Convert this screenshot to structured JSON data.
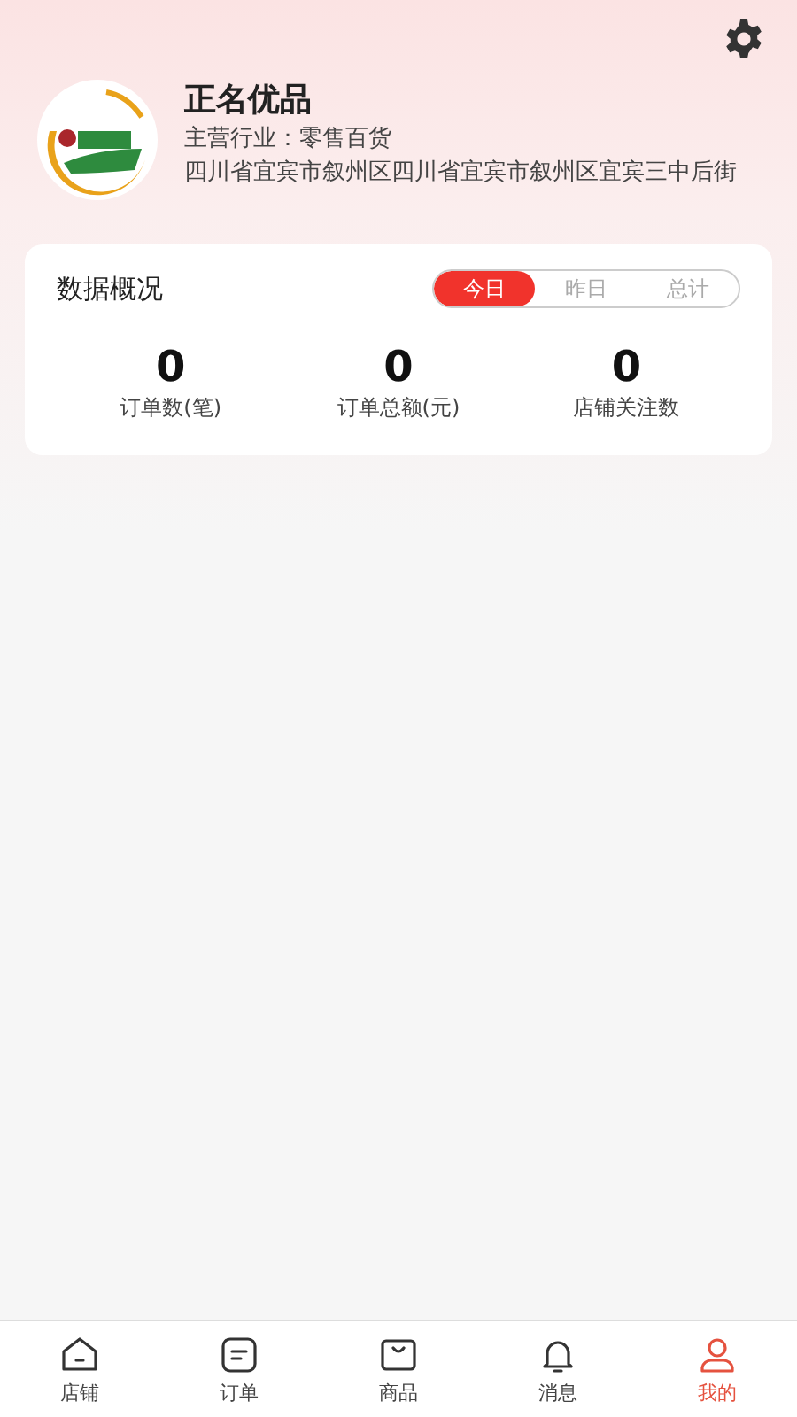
{
  "store": {
    "name": "正名优品",
    "industry": "主营行业：零售百货",
    "address": "四川省宜宾市叙州区四川省宜宾市叙州区宜宾三中后街"
  },
  "overview": {
    "title": "数据概况",
    "tabs": [
      {
        "label": "今日",
        "selected": true
      },
      {
        "label": "昨日",
        "selected": false
      },
      {
        "label": "总计",
        "selected": false
      }
    ],
    "stats": [
      {
        "value": "0",
        "label": "订单数(笔)"
      },
      {
        "value": "0",
        "label": "订单总额(元)"
      },
      {
        "value": "0",
        "label": "店铺关注数"
      }
    ]
  },
  "nav": [
    {
      "label": "店铺",
      "kind": "store",
      "selected": false
    },
    {
      "label": "订单",
      "kind": "order",
      "selected": false
    },
    {
      "label": "商品",
      "kind": "goods",
      "selected": false
    },
    {
      "label": "消息",
      "kind": "bell",
      "selected": false
    },
    {
      "label": "我的",
      "kind": "user",
      "selected": true
    }
  ]
}
